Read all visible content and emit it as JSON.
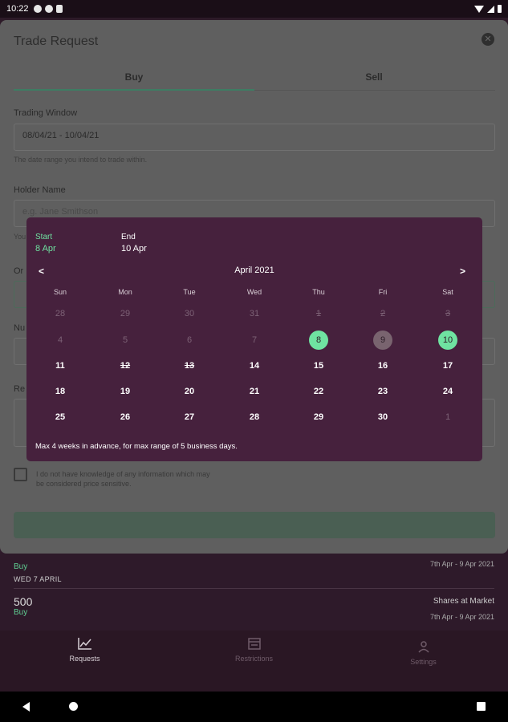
{
  "status_bar": {
    "time": "10:22"
  },
  "modal": {
    "title": "Trade Request",
    "tabs": [
      {
        "label": "Buy",
        "active": true
      },
      {
        "label": "Sell",
        "active": false
      }
    ],
    "trading_window": {
      "label": "Trading Window",
      "value": "08/04/21 - 10/04/21",
      "help": "The date range you intend to trade within."
    },
    "holder_name": {
      "label": "Holder Name",
      "placeholder": "e.g. Jane Smithson",
      "help_partial": "You"
    },
    "order_label_partial": "Or",
    "number_label_partial": "Nu",
    "reason_label_partial": "Re",
    "checkbox_label": "I do not have knowledge of any information which may be considered price sensitive."
  },
  "date_picker": {
    "start_label": "Start",
    "start_value": "8 Apr",
    "end_label": "End",
    "end_value": "10 Apr",
    "month": "April 2021",
    "prev": "<",
    "next": ">",
    "weekdays": [
      "Sun",
      "Mon",
      "Tue",
      "Wed",
      "Thu",
      "Fri",
      "Sat"
    ],
    "weeks": [
      [
        {
          "d": "28",
          "s": "faded"
        },
        {
          "d": "29",
          "s": "faded"
        },
        {
          "d": "30",
          "s": "faded"
        },
        {
          "d": "31",
          "s": "faded"
        },
        {
          "d": "1",
          "s": "faded struck"
        },
        {
          "d": "2",
          "s": "faded struck"
        },
        {
          "d": "3",
          "s": "faded struck"
        }
      ],
      [
        {
          "d": "4",
          "s": "faded"
        },
        {
          "d": "5",
          "s": "faded"
        },
        {
          "d": "6",
          "s": "faded"
        },
        {
          "d": "7",
          "s": "faded"
        },
        {
          "d": "8",
          "s": "sel-start"
        },
        {
          "d": "9",
          "s": "in-range"
        },
        {
          "d": "10",
          "s": "sel-end"
        }
      ],
      [
        {
          "d": "11",
          "s": ""
        },
        {
          "d": "12",
          "s": "struck"
        },
        {
          "d": "13",
          "s": "struck"
        },
        {
          "d": "14",
          "s": ""
        },
        {
          "d": "15",
          "s": ""
        },
        {
          "d": "16",
          "s": ""
        },
        {
          "d": "17",
          "s": ""
        }
      ],
      [
        {
          "d": "18",
          "s": ""
        },
        {
          "d": "19",
          "s": ""
        },
        {
          "d": "20",
          "s": ""
        },
        {
          "d": "21",
          "s": ""
        },
        {
          "d": "22",
          "s": ""
        },
        {
          "d": "23",
          "s": ""
        },
        {
          "d": "24",
          "s": ""
        }
      ],
      [
        {
          "d": "25",
          "s": ""
        },
        {
          "d": "26",
          "s": ""
        },
        {
          "d": "27",
          "s": ""
        },
        {
          "d": "28",
          "s": ""
        },
        {
          "d": "29",
          "s": ""
        },
        {
          "d": "30",
          "s": ""
        },
        {
          "d": "1",
          "s": "faded"
        }
      ]
    ],
    "note": "Max 4 weeks in advance, for max range of 5 business days."
  },
  "background_list": {
    "row1": {
      "side": "Buy",
      "date": "7th Apr - 9 Apr 2021"
    },
    "section_header": "WED 7 APRIL",
    "row2": {
      "quantity": "500",
      "side": "Buy",
      "type": "Shares at Market",
      "date": "7th Apr - 9 Apr 2021"
    }
  },
  "bottom_nav": [
    {
      "label": "Requests",
      "icon": "chart-icon",
      "active": true
    },
    {
      "label": "Restrictions",
      "icon": "calendar-icon",
      "active": false
    },
    {
      "label": "Settings",
      "icon": "person-icon",
      "active": false
    }
  ],
  "colors": {
    "accent_green": "#6fe3a1",
    "picker_bg": "#46213d",
    "app_bg": "#2d1a28"
  }
}
